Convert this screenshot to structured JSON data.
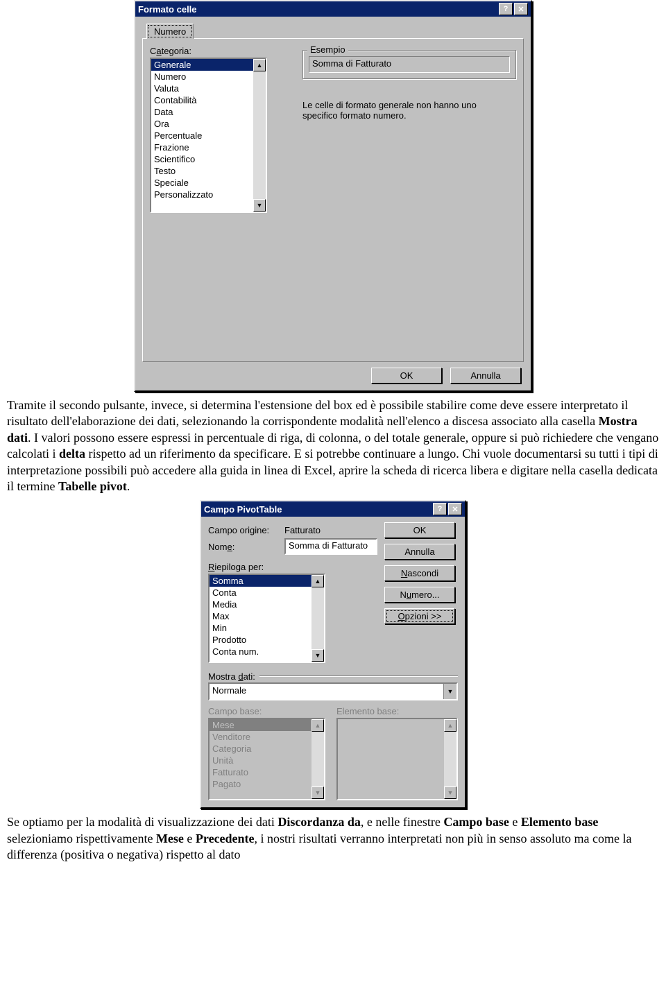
{
  "dialog1": {
    "title": "Formato celle",
    "titlebar": {
      "help": "?",
      "close": "✕"
    },
    "tab_label": "Numero",
    "category_label_pre": "C",
    "category_label_u": "a",
    "category_label_post": "tegoria:",
    "category_items": [
      "Generale",
      "Numero",
      "Valuta",
      "Contabilità",
      "Data",
      "Ora",
      "Percentuale",
      "Frazione",
      "Scientifico",
      "Testo",
      "Speciale",
      "Personalizzato"
    ],
    "example_legend": "Esempio",
    "example_value": "Somma di Fatturato",
    "description": "Le celle di formato generale non hanno uno specifico formato numero.",
    "ok": "OK",
    "cancel": "Annulla"
  },
  "paragraph1": {
    "pre_bold1": "Tramite il secondo pulsante, invece, si determina l'estensione del box ed è possibile stabilire come deve essere interpretato il risultato dell'elaborazione dei dati, selezionando la corrispondente modalità nell'elenco a discesa associato alla casella ",
    "bold1": "Mostra dati",
    "mid1": ". I valori possono essere espressi in percentuale di riga, di colonna, o del totale generale, oppure si può richiedere che vengano calcolati i ",
    "bold2": "delta",
    "mid2": " rispetto ad un riferimento da specificare. E si potrebbe continuare a lungo. Chi vuole documentarsi su tutti i tipi di interpretazione possibili può accedere alla guida in linea di Excel, aprire la scheda di ricerca libera e digitare nella casella dedicata il termine ",
    "bold3": "Tabelle pivot",
    "post": "."
  },
  "dialog2": {
    "title": "Campo PivotTable",
    "titlebar": {
      "help": "?",
      "close": "✕"
    },
    "campo_origine_label": "Campo origine:",
    "campo_origine_value": "Fatturato",
    "nome_label_pre": "Nom",
    "nome_label_u": "e",
    "nome_label_post": ":",
    "nome_value": "Somma di Fatturato",
    "riepiloga_label_u": "R",
    "riepiloga_label": "iepiloga per:",
    "riepiloga_items": [
      "Somma",
      "Conta",
      "Media",
      "Max",
      "Min",
      "Prodotto",
      "Conta num."
    ],
    "btn_ok": "OK",
    "btn_annulla": "Annulla",
    "btn_nascondi_u": "N",
    "btn_nascondi": "ascondi",
    "btn_numero_pre": "N",
    "btn_numero_u": "u",
    "btn_numero_post": "mero...",
    "btn_opzioni_u": "O",
    "btn_opzioni": "pzioni >>",
    "mostra_dati_label_pre": "Mostra ",
    "mostra_dati_label_u": "d",
    "mostra_dati_label_post": "ati:",
    "mostra_dati_value": "Normale",
    "campo_base_label": "Campo base:",
    "elemento_base_label": "Elemento base:",
    "campo_base_items": [
      "Mese",
      "Venditore",
      "Categoria",
      "Unità",
      "Fatturato",
      "Pagato"
    ]
  },
  "paragraph2": {
    "pre": "Se optiamo per la modalità di visualizzazione dei dati ",
    "b1": "Discordanza da",
    "m1": ", e nelle finestre ",
    "b2": "Campo base",
    "m2": " e ",
    "b3": "Elemento base",
    "m3": " selezioniamo rispettivamente ",
    "b4": "Mese",
    "m4": " e ",
    "b5": "Precedente",
    "post": ", i nostri risultati verranno interpretati non più in senso assoluto ma come la differenza (positiva o negativa) rispetto al dato"
  }
}
